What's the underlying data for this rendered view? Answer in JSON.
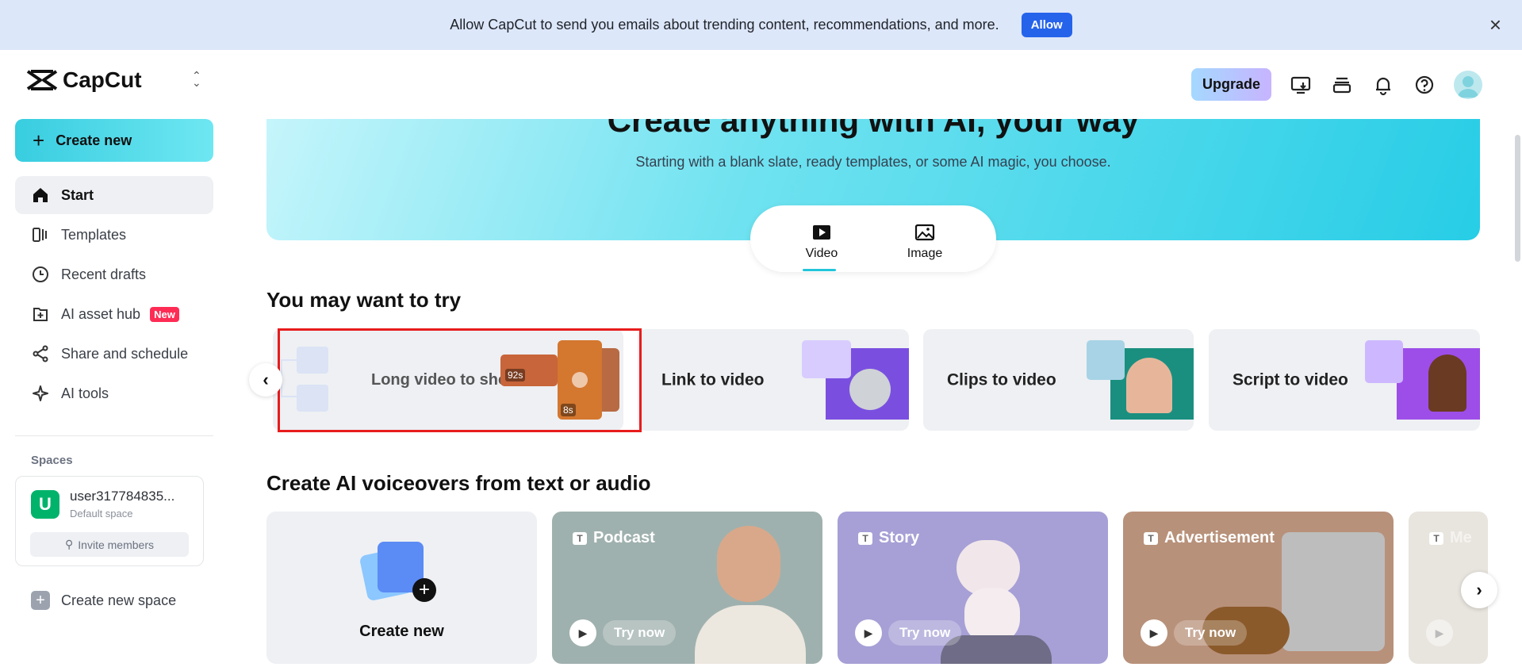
{
  "banner": {
    "message": "Allow CapCut to send you emails about trending content, recommendations, and more.",
    "allow_label": "Allow",
    "close_icon": "×"
  },
  "app": {
    "logo_text": "CapCut"
  },
  "sidebar": {
    "create_new": "Create new",
    "items": [
      {
        "label": "Start",
        "icon": "home-icon"
      },
      {
        "label": "Templates",
        "icon": "templates-icon"
      },
      {
        "label": "Recent drafts",
        "icon": "clock-icon"
      },
      {
        "label": "AI asset hub",
        "icon": "asset-hub-icon",
        "badge": "New"
      },
      {
        "label": "Share and schedule",
        "icon": "share-icon"
      },
      {
        "label": "AI tools",
        "icon": "sparkle-icon"
      }
    ],
    "spaces_title": "Spaces",
    "space": {
      "avatar_letter": "U",
      "name": "user317784835...",
      "sub": "Default space",
      "invite": "Invite members"
    },
    "create_space": "Create new space"
  },
  "topbar": {
    "upgrade": "Upgrade"
  },
  "hero": {
    "title": "Create anything with AI, your way",
    "subtitle": "Starting with a blank slate, ready templates, or some AI magic, you choose.",
    "modes": [
      "Video",
      "Image"
    ]
  },
  "try_section": {
    "title": "You may want to try",
    "cards": [
      {
        "label": "Long video to shorts",
        "badge1": "92s",
        "badge2": "8s"
      },
      {
        "label": "Link to video"
      },
      {
        "label": "Clips to video"
      },
      {
        "label": "Script to video"
      }
    ]
  },
  "voiceover_section": {
    "title": "Create AI voiceovers from text or audio",
    "create_new": "Create new",
    "cards": [
      {
        "tag": "Podcast",
        "cta": "Try now",
        "color": "#9fb1ae"
      },
      {
        "tag": "Story",
        "cta": "Try now",
        "color": "#a6a0d6"
      },
      {
        "tag": "Advertisement",
        "cta": "Try now",
        "color": "#b8917a"
      },
      {
        "tag": "Me",
        "color": "#e8e4de"
      }
    ]
  },
  "colors": {
    "accent": "#22c5da",
    "allow_button": "#2563eb",
    "badge_new": "#fe2c55",
    "highlight": "#e81c1c"
  }
}
